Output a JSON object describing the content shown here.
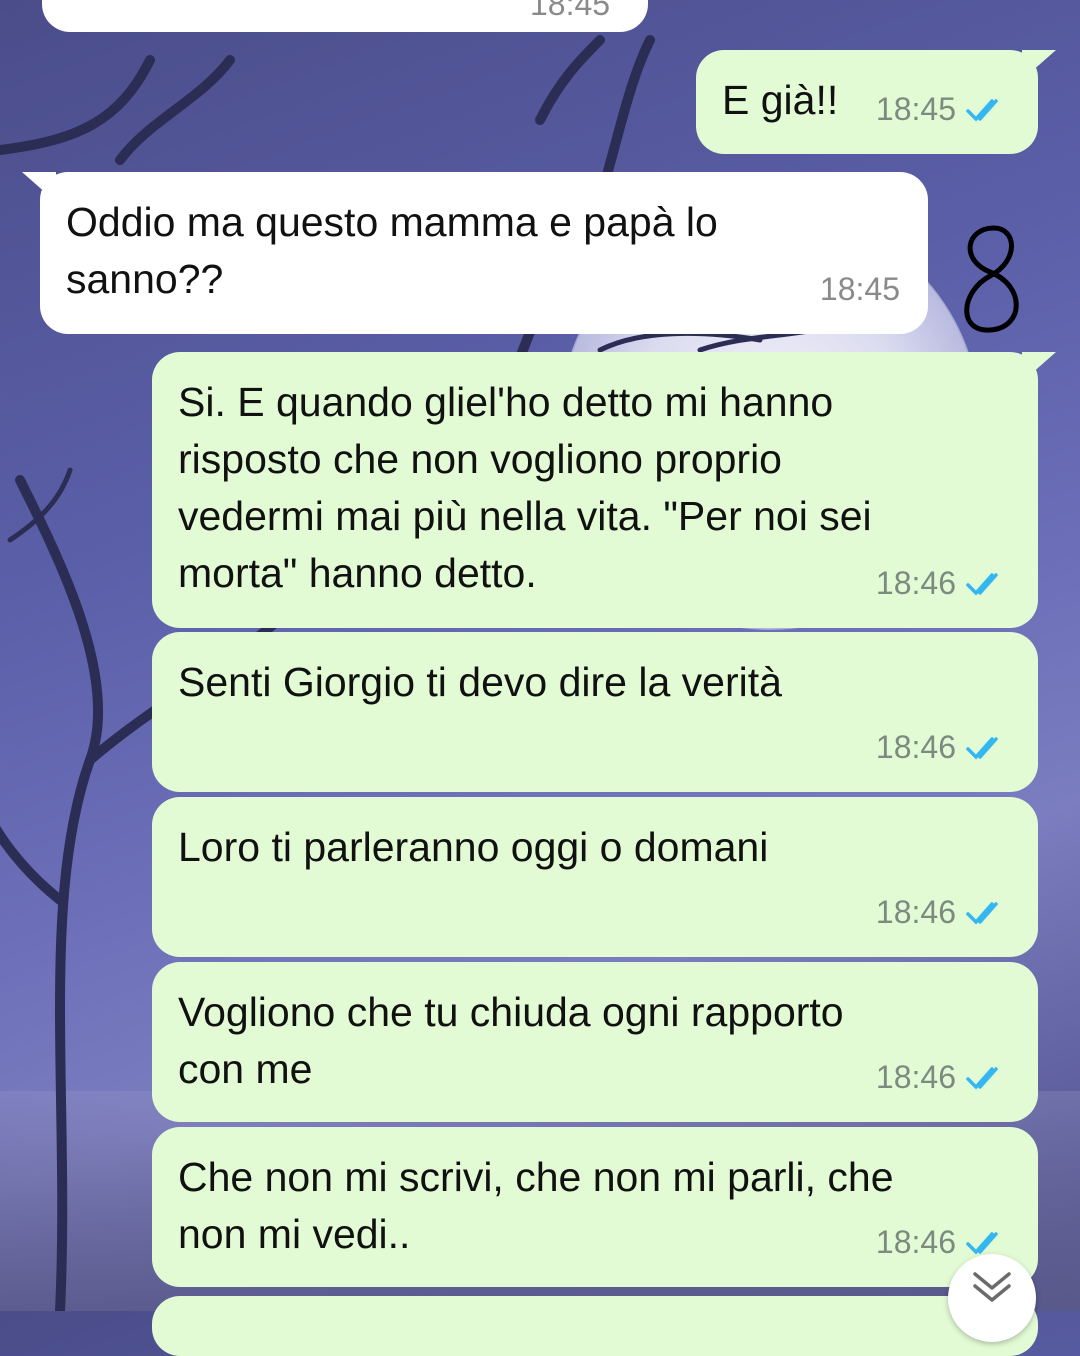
{
  "chat": {
    "top_partial_time": "18:45",
    "messages": [
      {
        "dir": "out",
        "text": "E già!!",
        "time": "18:45"
      },
      {
        "dir": "in",
        "text": "Oddio ma questo mamma e papà lo sanno??",
        "time": "18:45"
      },
      {
        "dir": "out",
        "text": "Si. E quando gliel'ho detto mi hanno risposto che non vogliono proprio vedermi mai più nella vita. \"Per noi sei morta\" hanno detto.",
        "time": "18:46"
      },
      {
        "dir": "out",
        "text": "Senti Giorgio ti devo dire la verità",
        "time": "18:46"
      },
      {
        "dir": "out",
        "text": "Loro ti parleranno oggi o domani",
        "time": "18:46"
      },
      {
        "dir": "out",
        "text": "Vogliono che tu chiuda ogni rapporto con me",
        "time": "18:46"
      },
      {
        "dir": "out",
        "text": "Che non mi scrivi, che non mi parli, che non mi vedi..",
        "time": "18:46"
      }
    ],
    "annotation": "8"
  },
  "colors": {
    "outgoing_bubble": "#e2fbd5",
    "incoming_bubble": "#ffffff",
    "read_check": "#34b7f1"
  },
  "icons": {
    "read_receipt": "double-check-icon",
    "scroll_down": "chevron-down-double-icon"
  }
}
